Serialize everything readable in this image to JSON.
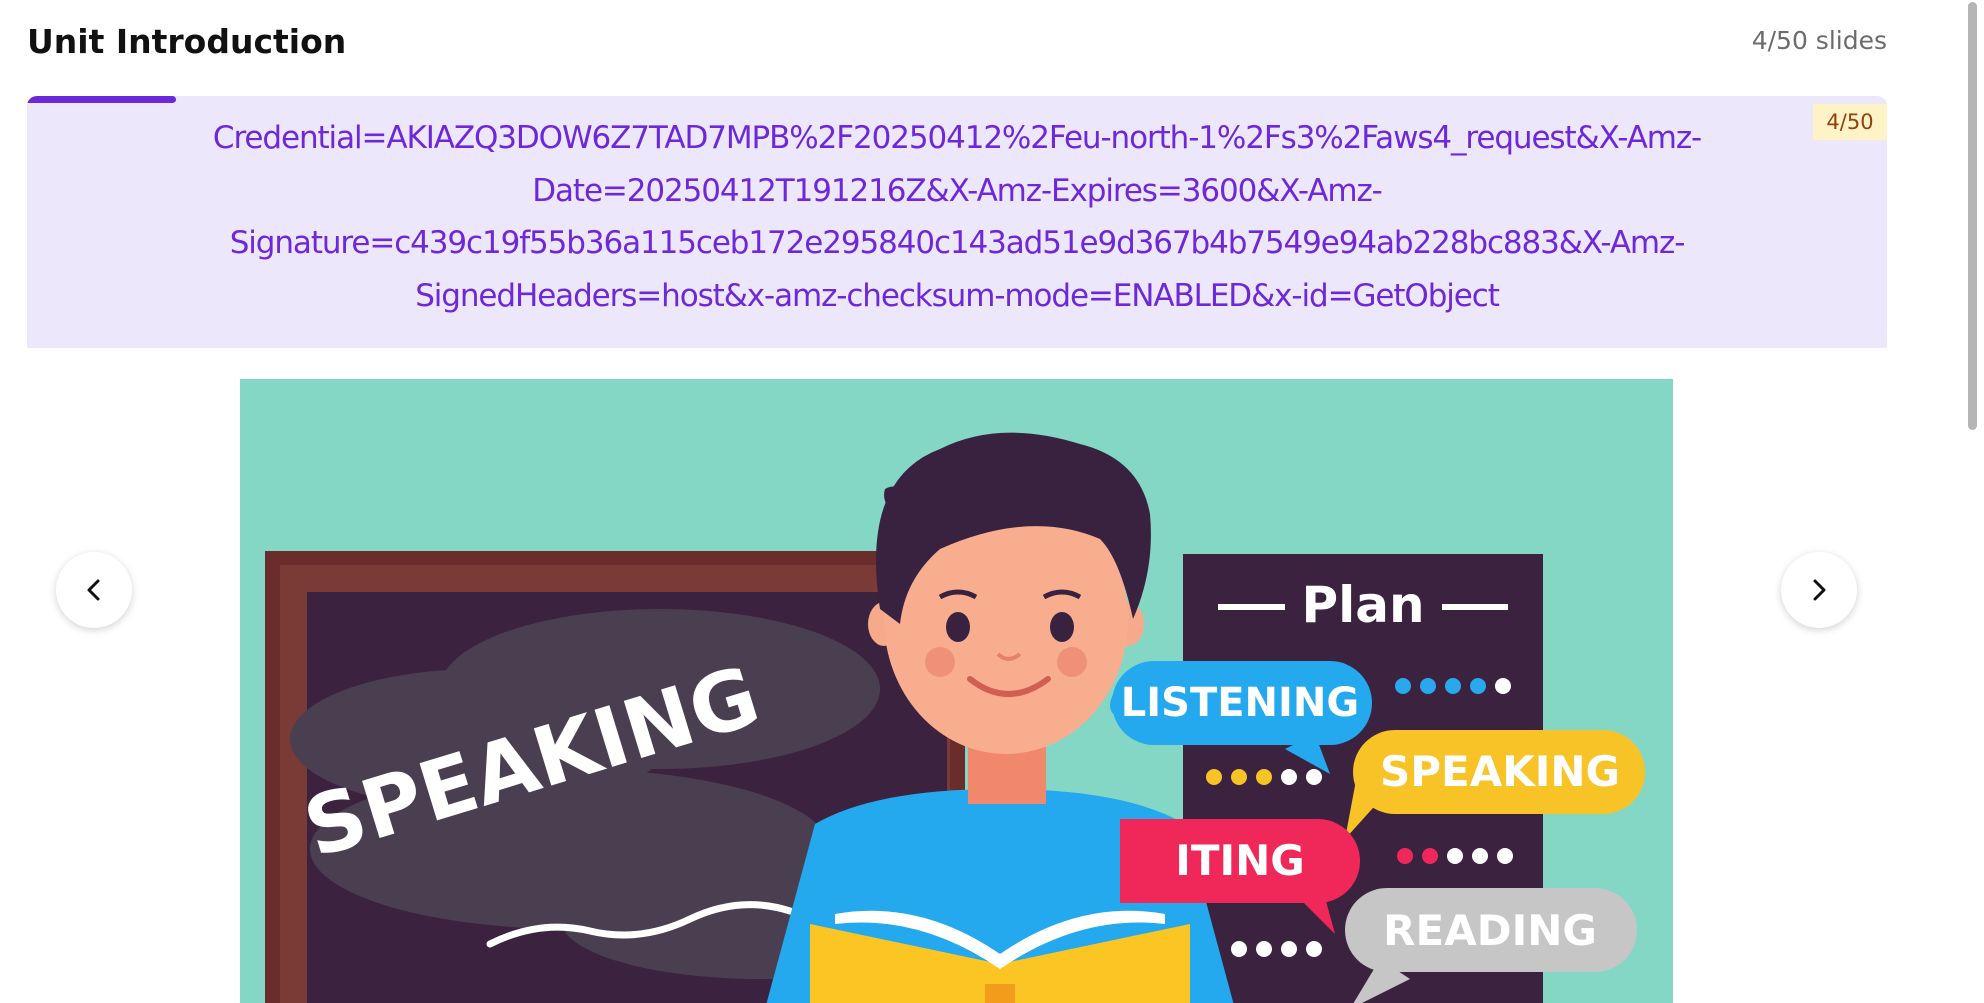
{
  "header": {
    "title": "Unit Introduction",
    "slide_count": "4/50 slides"
  },
  "caption": {
    "lines": [
      "Credential=AKIAZQ3DOW6Z7TAD7MPB%2F20250412%2Feu-north-1%2Fs3%2Faws4_request&X-Amz-",
      "Date=20250412T191216Z&X-Amz-Expires=3600&X-Amz-",
      "Signature=c439c19f55b36a115ceb172e295840c143ad51e9d367b4b7549e94ab228bc883&X-Amz-",
      "SignedHeaders=host&x-amz-checksum-mode=ENABLED&x-id=GetObject"
    ],
    "badge": "4/50",
    "progress_fraction": 0.08
  },
  "slide": {
    "chalkboard_word": "SPEAKING",
    "panel_title": "Plan",
    "bubbles": {
      "listening": "LISTENING",
      "speaking": "SPEAKING",
      "writing": "ITING",
      "reading": "READING"
    }
  },
  "nav": {
    "prev_icon": "chevron-left-icon",
    "next_icon": "chevron-right-icon"
  },
  "colors": {
    "accent": "#6d28d9",
    "caption_bg": "#ede7fb",
    "slide_bg": "#85d7c5"
  }
}
